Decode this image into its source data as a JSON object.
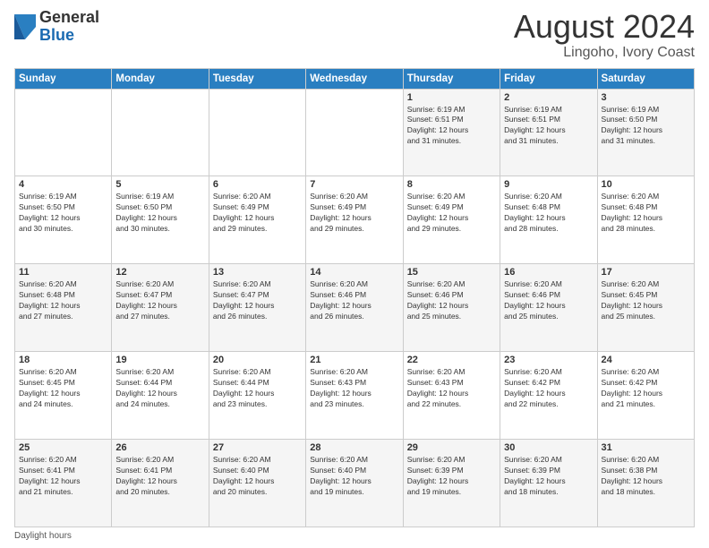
{
  "header": {
    "logo_general": "General",
    "logo_blue": "Blue",
    "title": "August 2024",
    "location": "Lingoho, Ivory Coast"
  },
  "days_of_week": [
    "Sunday",
    "Monday",
    "Tuesday",
    "Wednesday",
    "Thursday",
    "Friday",
    "Saturday"
  ],
  "footer": {
    "daylight_label": "Daylight hours"
  },
  "weeks": [
    [
      {
        "day": "",
        "info": ""
      },
      {
        "day": "",
        "info": ""
      },
      {
        "day": "",
        "info": ""
      },
      {
        "day": "",
        "info": ""
      },
      {
        "day": "1",
        "info": "Sunrise: 6:19 AM\nSunset: 6:51 PM\nDaylight: 12 hours\nand 31 minutes."
      },
      {
        "day": "2",
        "info": "Sunrise: 6:19 AM\nSunset: 6:51 PM\nDaylight: 12 hours\nand 31 minutes."
      },
      {
        "day": "3",
        "info": "Sunrise: 6:19 AM\nSunset: 6:50 PM\nDaylight: 12 hours\nand 31 minutes."
      }
    ],
    [
      {
        "day": "4",
        "info": "Sunrise: 6:19 AM\nSunset: 6:50 PM\nDaylight: 12 hours\nand 30 minutes."
      },
      {
        "day": "5",
        "info": "Sunrise: 6:19 AM\nSunset: 6:50 PM\nDaylight: 12 hours\nand 30 minutes."
      },
      {
        "day": "6",
        "info": "Sunrise: 6:20 AM\nSunset: 6:49 PM\nDaylight: 12 hours\nand 29 minutes."
      },
      {
        "day": "7",
        "info": "Sunrise: 6:20 AM\nSunset: 6:49 PM\nDaylight: 12 hours\nand 29 minutes."
      },
      {
        "day": "8",
        "info": "Sunrise: 6:20 AM\nSunset: 6:49 PM\nDaylight: 12 hours\nand 29 minutes."
      },
      {
        "day": "9",
        "info": "Sunrise: 6:20 AM\nSunset: 6:48 PM\nDaylight: 12 hours\nand 28 minutes."
      },
      {
        "day": "10",
        "info": "Sunrise: 6:20 AM\nSunset: 6:48 PM\nDaylight: 12 hours\nand 28 minutes."
      }
    ],
    [
      {
        "day": "11",
        "info": "Sunrise: 6:20 AM\nSunset: 6:48 PM\nDaylight: 12 hours\nand 27 minutes."
      },
      {
        "day": "12",
        "info": "Sunrise: 6:20 AM\nSunset: 6:47 PM\nDaylight: 12 hours\nand 27 minutes."
      },
      {
        "day": "13",
        "info": "Sunrise: 6:20 AM\nSunset: 6:47 PM\nDaylight: 12 hours\nand 26 minutes."
      },
      {
        "day": "14",
        "info": "Sunrise: 6:20 AM\nSunset: 6:46 PM\nDaylight: 12 hours\nand 26 minutes."
      },
      {
        "day": "15",
        "info": "Sunrise: 6:20 AM\nSunset: 6:46 PM\nDaylight: 12 hours\nand 25 minutes."
      },
      {
        "day": "16",
        "info": "Sunrise: 6:20 AM\nSunset: 6:46 PM\nDaylight: 12 hours\nand 25 minutes."
      },
      {
        "day": "17",
        "info": "Sunrise: 6:20 AM\nSunset: 6:45 PM\nDaylight: 12 hours\nand 25 minutes."
      }
    ],
    [
      {
        "day": "18",
        "info": "Sunrise: 6:20 AM\nSunset: 6:45 PM\nDaylight: 12 hours\nand 24 minutes."
      },
      {
        "day": "19",
        "info": "Sunrise: 6:20 AM\nSunset: 6:44 PM\nDaylight: 12 hours\nand 24 minutes."
      },
      {
        "day": "20",
        "info": "Sunrise: 6:20 AM\nSunset: 6:44 PM\nDaylight: 12 hours\nand 23 minutes."
      },
      {
        "day": "21",
        "info": "Sunrise: 6:20 AM\nSunset: 6:43 PM\nDaylight: 12 hours\nand 23 minutes."
      },
      {
        "day": "22",
        "info": "Sunrise: 6:20 AM\nSunset: 6:43 PM\nDaylight: 12 hours\nand 22 minutes."
      },
      {
        "day": "23",
        "info": "Sunrise: 6:20 AM\nSunset: 6:42 PM\nDaylight: 12 hours\nand 22 minutes."
      },
      {
        "day": "24",
        "info": "Sunrise: 6:20 AM\nSunset: 6:42 PM\nDaylight: 12 hours\nand 21 minutes."
      }
    ],
    [
      {
        "day": "25",
        "info": "Sunrise: 6:20 AM\nSunset: 6:41 PM\nDaylight: 12 hours\nand 21 minutes."
      },
      {
        "day": "26",
        "info": "Sunrise: 6:20 AM\nSunset: 6:41 PM\nDaylight: 12 hours\nand 20 minutes."
      },
      {
        "day": "27",
        "info": "Sunrise: 6:20 AM\nSunset: 6:40 PM\nDaylight: 12 hours\nand 20 minutes."
      },
      {
        "day": "28",
        "info": "Sunrise: 6:20 AM\nSunset: 6:40 PM\nDaylight: 12 hours\nand 19 minutes."
      },
      {
        "day": "29",
        "info": "Sunrise: 6:20 AM\nSunset: 6:39 PM\nDaylight: 12 hours\nand 19 minutes."
      },
      {
        "day": "30",
        "info": "Sunrise: 6:20 AM\nSunset: 6:39 PM\nDaylight: 12 hours\nand 18 minutes."
      },
      {
        "day": "31",
        "info": "Sunrise: 6:20 AM\nSunset: 6:38 PM\nDaylight: 12 hours\nand 18 minutes."
      }
    ]
  ]
}
